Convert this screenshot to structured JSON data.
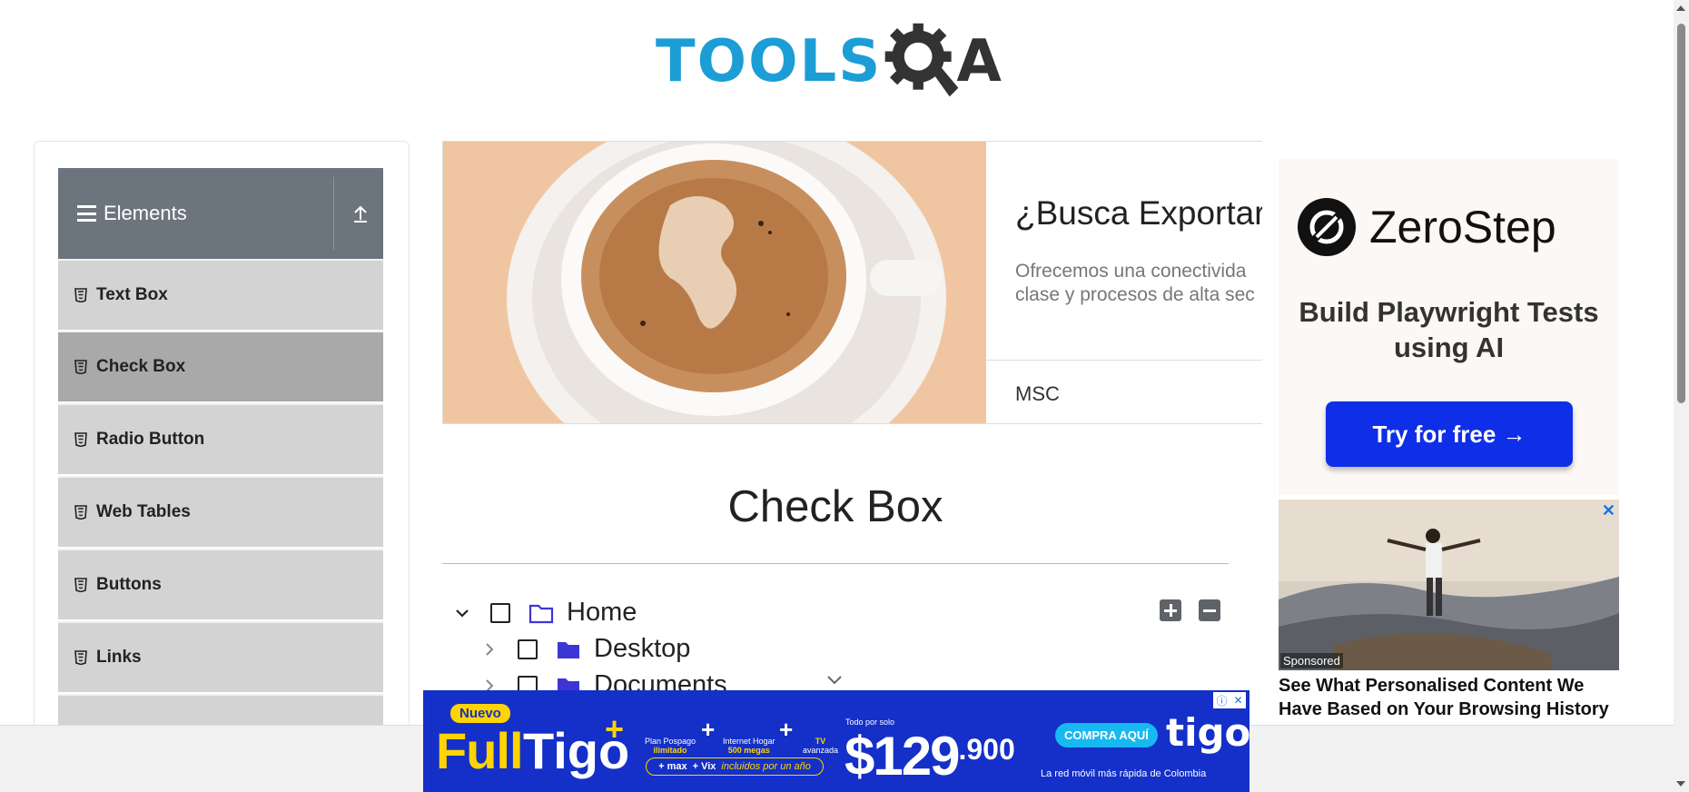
{
  "header": {
    "logo_text_main": "TOOLS",
    "logo_text_end": "A",
    "logo_alt": "TOOLSQA"
  },
  "sidebar": {
    "group_title": "Elements",
    "items": [
      {
        "label": "Text Box",
        "active": false
      },
      {
        "label": "Check Box",
        "active": true
      },
      {
        "label": "Radio Button",
        "active": false
      },
      {
        "label": "Web Tables",
        "active": false
      },
      {
        "label": "Buttons",
        "active": false
      },
      {
        "label": "Links",
        "active": false
      }
    ]
  },
  "top_ad": {
    "headline": "¿Busca Exportar",
    "body": "Ofrecemos una conectivida clase y procesos de alta sec",
    "brand": "MSC"
  },
  "main": {
    "title": "Check Box",
    "tree": [
      {
        "label": "Home",
        "expanded": true,
        "level": 0
      },
      {
        "label": "Desktop",
        "expanded": false,
        "level": 1
      },
      {
        "label": "Documents",
        "expanded": false,
        "level": 1
      }
    ]
  },
  "right_ad": {
    "brand": "ZeroStep",
    "headline": "Build Playwright Tests using AI",
    "button": "Try for free →",
    "sponsored_badge": "Sponsored",
    "sponsored_close": "✕",
    "sponsored_text": "See What Personalised Content We Have Based on Your Browsing History"
  },
  "bottom_ad": {
    "badge": "Nuevo",
    "brand_full": "Full",
    "brand_tigo": "Tigo",
    "brand_plus": "+",
    "feature_1_line1": "Plan Pospago",
    "feature_1_line2": "ilimitado",
    "feature_2_line1": "Internet Hogar",
    "feature_2_line2": "500 megas",
    "feature_3_line1": "TV",
    "feature_3_line2": "avanzada",
    "pill_1": "+ max",
    "pill_2": "+ Vix",
    "pill_text": "incluidos por un año",
    "todo": "Todo por solo",
    "price_main": "$129",
    "price_decimal": ".900",
    "cta": "COMPRA AQUÍ",
    "logo": "tigo",
    "tagline": "La red móvil más rápida de Colombia"
  },
  "colors": {
    "logo_blue": "#1c9dd6",
    "sidebar_header": "#6c757d",
    "menu_item": "#d3d3d3",
    "menu_item_active": "#a9a9a9",
    "zerostep_button": "#0f2ee8",
    "tigo_blue": "#1430c8",
    "tigo_yellow": "#ffd400",
    "folder": "#3e36d4"
  }
}
